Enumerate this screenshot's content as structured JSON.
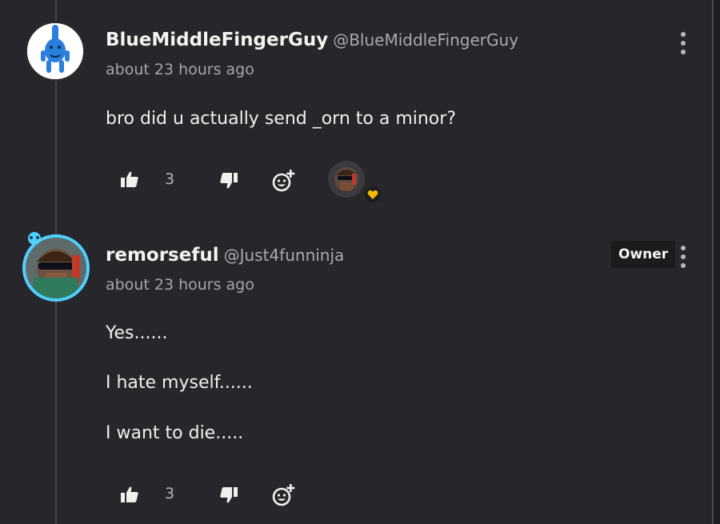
{
  "comments": [
    {
      "username": "BlueMiddleFingerGuy",
      "handle": "@BlueMiddleFingerGuy",
      "time": "about 23 hours ago",
      "body": [
        "bro did u actually send _orn to a minor?"
      ],
      "likes": "3",
      "avatar_icon": "blue-figure-avatar",
      "reaction_icon": "heart-icon",
      "reaction_color": "#f5b800"
    },
    {
      "username": "remorseful",
      "handle": "@Just4funninja",
      "time": "about 23 hours ago",
      "badge": "Owner",
      "body": [
        "Yes......",
        "I hate myself......",
        "I want to die....."
      ],
      "likes": "3",
      "avatar_ring_color": "#4fd0ff"
    }
  ],
  "colors": {
    "background": "#27272b",
    "text": "#f0f0f0",
    "muted": "#a5a5aa"
  }
}
